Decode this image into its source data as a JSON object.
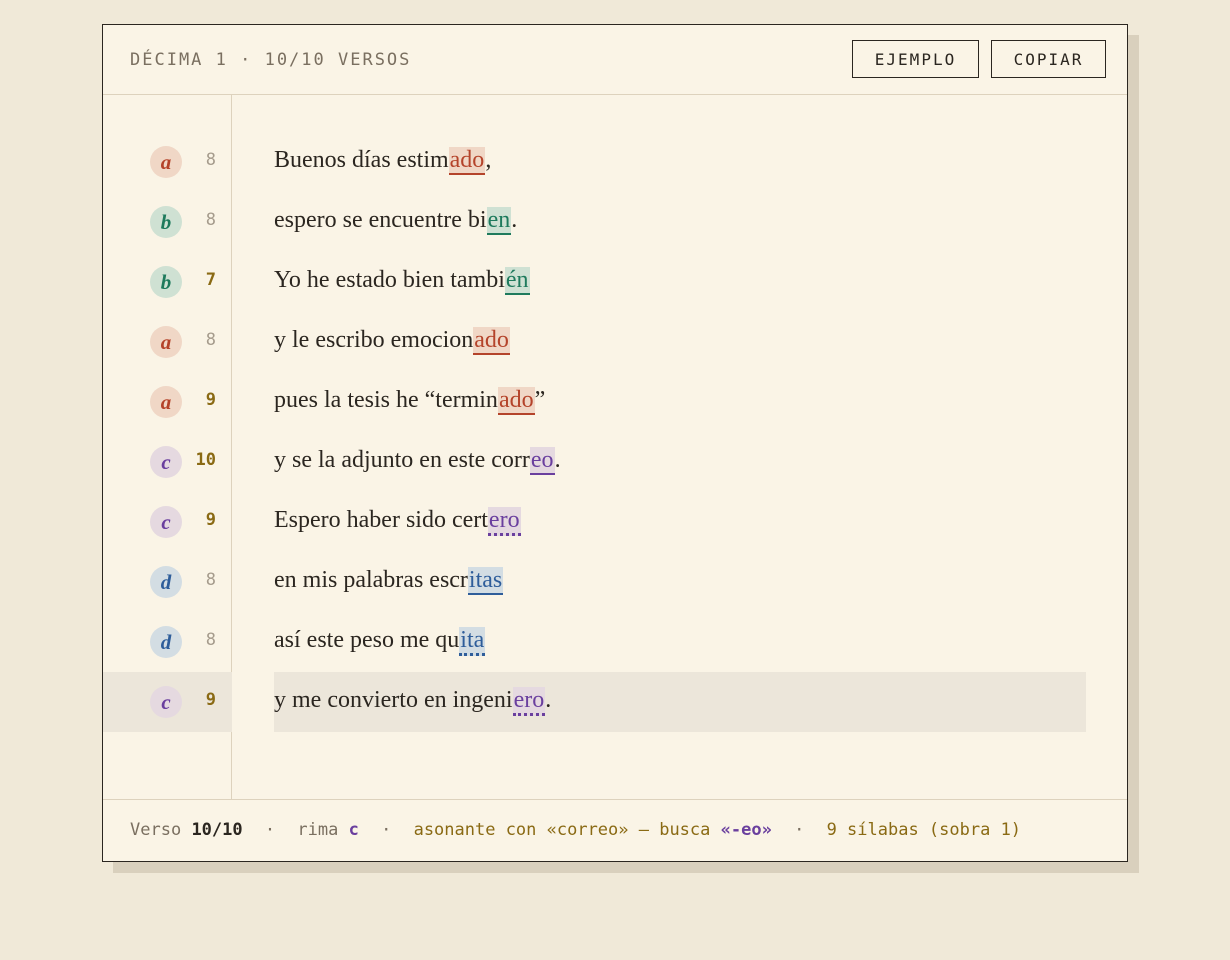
{
  "header": {
    "title": "DÉCIMA 1 · 10/10 VERSOS",
    "buttons": {
      "ejemplo": "EJEMPLO",
      "copiar": "COPIAR"
    }
  },
  "colors": {
    "a": "#b4432a",
    "b": "#1e7a5c",
    "c": "#6a3f9e",
    "d": "#2e5d9a",
    "warn": "#8a6a14"
  },
  "verses": [
    {
      "rhyme": "a",
      "syllables": "8",
      "warn": false,
      "pre": "Buenos días estim",
      "rh": "ado",
      "post": ",",
      "style": "solid",
      "active": false
    },
    {
      "rhyme": "b",
      "syllables": "8",
      "warn": false,
      "pre": "espero se encuentre bi",
      "rh": "en",
      "post": ".",
      "style": "solid",
      "active": false
    },
    {
      "rhyme": "b",
      "syllables": "7",
      "warn": true,
      "pre": "Yo he estado bien tambi",
      "rh": "én",
      "post": "",
      "style": "solid",
      "active": false
    },
    {
      "rhyme": "a",
      "syllables": "8",
      "warn": false,
      "pre": "y le escribo emocion",
      "rh": "ado",
      "post": "",
      "style": "solid",
      "active": false
    },
    {
      "rhyme": "a",
      "syllables": "9",
      "warn": true,
      "pre": "pues la tesis he “termin",
      "rh": "ado",
      "post": "”",
      "style": "solid",
      "active": false
    },
    {
      "rhyme": "c",
      "syllables": "10",
      "warn": true,
      "pre": "y se la adjunto en este corr",
      "rh": "eo",
      "post": ".",
      "style": "solid",
      "active": false
    },
    {
      "rhyme": "c",
      "syllables": "9",
      "warn": true,
      "pre": "Espero haber sido cert",
      "rh": "ero",
      "post": "",
      "style": "dot",
      "active": false
    },
    {
      "rhyme": "d",
      "syllables": "8",
      "warn": false,
      "pre": "en mis palabras escr",
      "rh": "itas",
      "post": "",
      "style": "solid",
      "active": false
    },
    {
      "rhyme": "d",
      "syllables": "8",
      "warn": false,
      "pre": "así este peso me qu",
      "rh": "ita",
      "post": "",
      "style": "dot",
      "active": false
    },
    {
      "rhyme": "c",
      "syllables": "9",
      "warn": true,
      "pre": "y me convierto en ingeni",
      "rh": "ero",
      "post": ".",
      "style": "dot",
      "active": true
    }
  ],
  "footer": {
    "verso_label": "Verso",
    "verso_value": "10/10",
    "sep": "·",
    "rima_label": "rima",
    "rima_value": "c",
    "asonante": "asonante con «correo» — busca",
    "busca_value": "«-eo»",
    "silabas": "9 sílabas (sobra 1)"
  }
}
